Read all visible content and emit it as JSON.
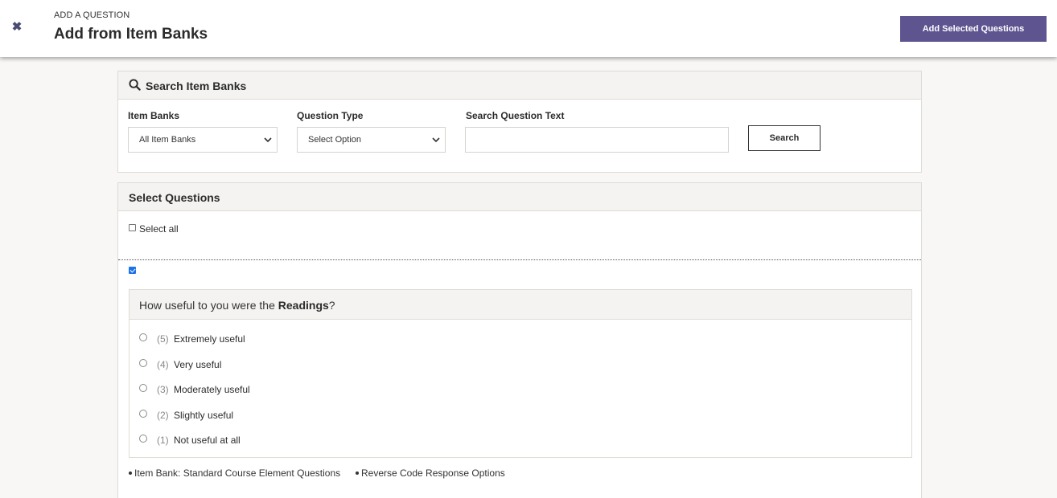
{
  "header": {
    "close_icon": "close-icon",
    "eyebrow": "ADD A QUESTION",
    "title": "Add from Item Banks",
    "add_button_label": "Add Selected Questions"
  },
  "search_panel": {
    "title": "Search Item Banks",
    "icon": "search-icon",
    "item_banks": {
      "label": "Item Banks",
      "selected": "All Item Banks"
    },
    "question_type": {
      "label": "Question Type",
      "selected": "Select Option"
    },
    "search_text": {
      "label": "Search Question Text",
      "value": "",
      "placeholder": ""
    },
    "search_button_label": "Search"
  },
  "select_panel": {
    "title": "Select Questions",
    "select_all_label": "Select all",
    "select_all_checked": false,
    "question": {
      "checked": true,
      "text_before": "How useful to you were the ",
      "text_bold": "Readings",
      "text_after": "?",
      "options": [
        {
          "num": "(5)",
          "label": "Extremely useful"
        },
        {
          "num": "(4)",
          "label": "Very useful"
        },
        {
          "num": "(3)",
          "label": "Moderately useful"
        },
        {
          "num": "(2)",
          "label": "Slightly useful"
        },
        {
          "num": "(1)",
          "label": "Not useful at all"
        }
      ],
      "meta": [
        "Item Bank: Standard Course Element Questions",
        "Reverse Code Response Options"
      ]
    }
  },
  "colors": {
    "accent": "#5d5490",
    "close_icon": "#4a4d73",
    "checkbox_checked": "#1a73e8"
  }
}
